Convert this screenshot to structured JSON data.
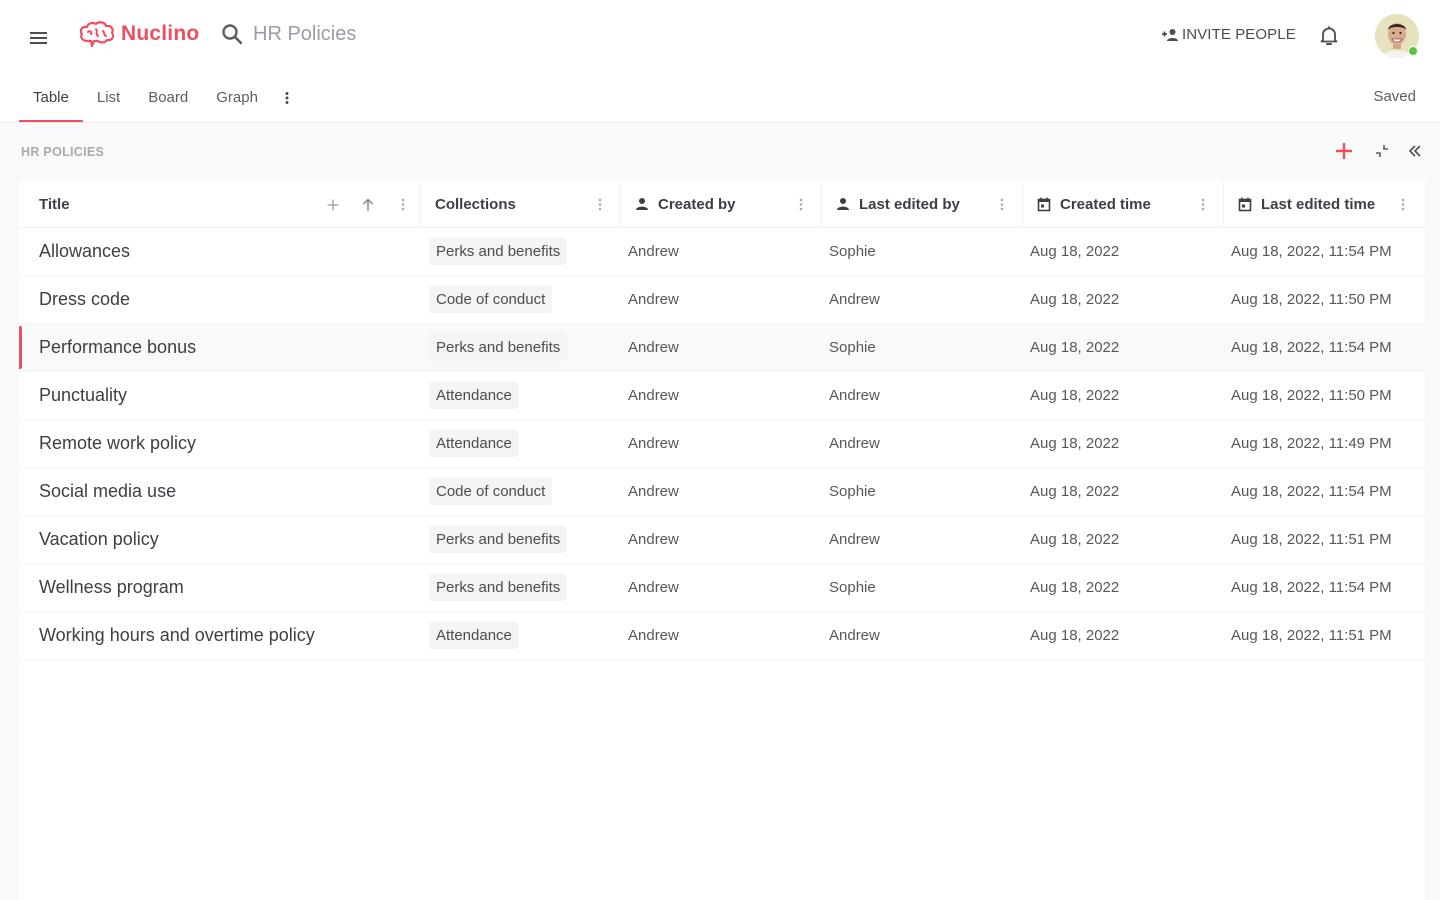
{
  "app": {
    "brand": "Nuclino",
    "search_text": "HR Policies",
    "invite_label": "INVITE PEOPLE",
    "status": "Saved",
    "accent_color": "#f04e5e",
    "presence_color": "#5ac43c"
  },
  "tabs": [
    {
      "label": "Table",
      "active": true
    },
    {
      "label": "List",
      "active": false
    },
    {
      "label": "Board",
      "active": false
    },
    {
      "label": "Graph",
      "active": false
    }
  ],
  "section": {
    "title": "HR POLICIES"
  },
  "table": {
    "columns": [
      {
        "label": "Title",
        "icon": ""
      },
      {
        "label": "Collections",
        "icon": ""
      },
      {
        "label": "Created by",
        "icon": "person-icon"
      },
      {
        "label": "Last edited by",
        "icon": "person-icon"
      },
      {
        "label": "Created time",
        "icon": "calendar-icon"
      },
      {
        "label": "Last edited time",
        "icon": "calendar-icon"
      }
    ],
    "rows": [
      {
        "title": "Allowances",
        "collection": "Perks and benefits",
        "created_by": "Andrew",
        "last_edited_by": "Sophie",
        "created_time": "Aug 18, 2022",
        "last_edited_time": "Aug 18, 2022, 11:54 PM"
      },
      {
        "title": "Dress code",
        "collection": "Code of conduct",
        "created_by": "Andrew",
        "last_edited_by": "Andrew",
        "created_time": "Aug 18, 2022",
        "last_edited_time": "Aug 18, 2022, 11:50 PM"
      },
      {
        "title": "Performance bonus",
        "collection": "Perks and benefits",
        "created_by": "Andrew",
        "last_edited_by": "Sophie",
        "created_time": "Aug 18, 2022",
        "last_edited_time": "Aug 18, 2022, 11:54 PM",
        "selected": true
      },
      {
        "title": "Punctuality",
        "collection": "Attendance",
        "created_by": "Andrew",
        "last_edited_by": "Andrew",
        "created_time": "Aug 18, 2022",
        "last_edited_time": "Aug 18, 2022, 11:50 PM"
      },
      {
        "title": "Remote work policy",
        "collection": "Attendance",
        "created_by": "Andrew",
        "last_edited_by": "Andrew",
        "created_time": "Aug 18, 2022",
        "last_edited_time": "Aug 18, 2022, 11:49 PM"
      },
      {
        "title": "Social media use",
        "collection": "Code of conduct",
        "created_by": "Andrew",
        "last_edited_by": "Sophie",
        "created_time": "Aug 18, 2022",
        "last_edited_time": "Aug 18, 2022, 11:54 PM"
      },
      {
        "title": "Vacation policy",
        "collection": "Perks and benefits",
        "created_by": "Andrew",
        "last_edited_by": "Andrew",
        "created_time": "Aug 18, 2022",
        "last_edited_time": "Aug 18, 2022, 11:51 PM"
      },
      {
        "title": "Wellness program",
        "collection": "Perks and benefits",
        "created_by": "Andrew",
        "last_edited_by": "Sophie",
        "created_time": "Aug 18, 2022",
        "last_edited_time": "Aug 18, 2022, 11:54 PM"
      },
      {
        "title": "Working hours and overtime policy",
        "collection": "Attendance",
        "created_by": "Andrew",
        "last_edited_by": "Andrew",
        "created_time": "Aug 18, 2022",
        "last_edited_time": "Aug 18, 2022, 11:51 PM"
      }
    ]
  }
}
